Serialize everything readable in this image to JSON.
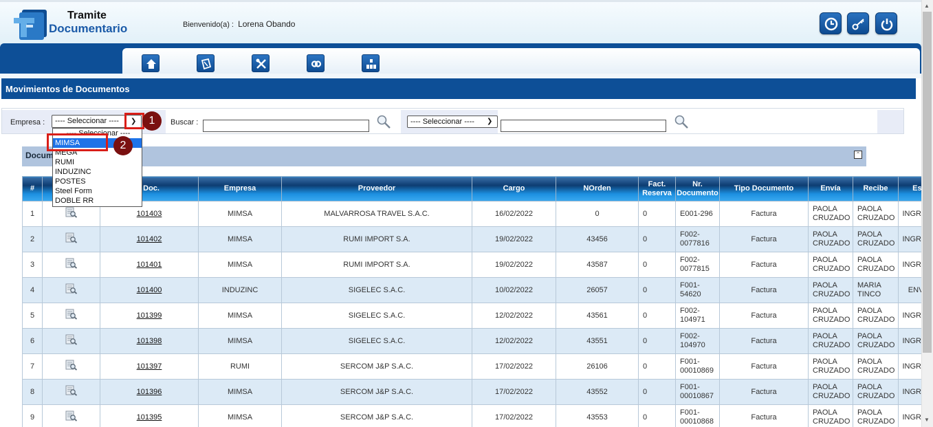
{
  "header": {
    "logo_line1": "Tramite",
    "logo_line2": "Documentario",
    "welcome_label": "Bienvenido(a) :",
    "user_name": "Lorena Obando",
    "buttons": [
      "clock-icon",
      "key-icon",
      "power-icon"
    ]
  },
  "nav": {
    "items": [
      "home-icon",
      "documents-icon",
      "tools-icon",
      "link-icon",
      "org-chart-icon"
    ]
  },
  "section": {
    "title": "Movimientos de Documentos"
  },
  "filter": {
    "empresa_label": "Empresa :",
    "empresa_selected": "---- Seleccionar ----",
    "buscar_label": "Buscar :",
    "second_select": "---- Seleccionar ----"
  },
  "dropdown": {
    "options": [
      "---- Seleccionar ----",
      "MIMSA",
      "MEGA",
      "RUMI",
      "INDUZINC",
      "POSTES",
      "Steel Form",
      "DOBLE RR"
    ],
    "highlighted": "MIMSA"
  },
  "annotations": [
    "1",
    "2"
  ],
  "panel": {
    "title": "Docum"
  },
  "table": {
    "headers": [
      "#",
      "",
      "l Doc.",
      "Empresa",
      "Proveedor",
      "Cargo",
      "NOrden",
      "Fact. Reserva",
      "Nr. Documento",
      "Tipo Documento",
      "Envía",
      "Recibe",
      "Estado"
    ],
    "rows": [
      [
        "1",
        "101403",
        "MIMSA",
        "MALVARROSA TRAVEL S.A.C.",
        "16/02/2022",
        "0",
        "0",
        "E001-296",
        "Factura",
        "PAOLA CRUZADO",
        "PAOLA CRUZADO",
        "INGRESADO"
      ],
      [
        "2",
        "101402",
        "MIMSA",
        "RUMI IMPORT S.A.",
        "19/02/2022",
        "43456",
        "0",
        "F002-0077816",
        "Factura",
        "PAOLA CRUZADO",
        "PAOLA CRUZADO",
        "INGRESADO"
      ],
      [
        "3",
        "101401",
        "MIMSA",
        "RUMI IMPORT S.A.",
        "19/02/2022",
        "43587",
        "0",
        "F002-0077815",
        "Factura",
        "PAOLA CRUZADO",
        "PAOLA CRUZADO",
        "INGRESADO"
      ],
      [
        "4",
        "101400",
        "INDUZINC",
        "SIGELEC S.A.C.",
        "10/02/2022",
        "26057",
        "0",
        "F001-54620",
        "Factura",
        "PAOLA CRUZADO",
        "MARIA TINCO",
        "ENVIADO"
      ],
      [
        "5",
        "101399",
        "MIMSA",
        "SIGELEC S.A.C.",
        "12/02/2022",
        "43561",
        "0",
        "F002-104971",
        "Factura",
        "PAOLA CRUZADO",
        "PAOLA CRUZADO",
        "INGRESADO"
      ],
      [
        "6",
        "101398",
        "MIMSA",
        "SIGELEC S.A.C.",
        "12/02/2022",
        "43551",
        "0",
        "F002-104970",
        "Factura",
        "PAOLA CRUZADO",
        "PAOLA CRUZADO",
        "INGRESADO"
      ],
      [
        "7",
        "101397",
        "RUMI",
        "SERCOM J&P S.A.C.",
        "17/02/2022",
        "26106",
        "0",
        "F001-00010869",
        "Factura",
        "PAOLA CRUZADO",
        "PAOLA CRUZADO",
        "INGRESADO"
      ],
      [
        "8",
        "101396",
        "MIMSA",
        "SERCOM J&P S.A.C.",
        "17/02/2022",
        "43552",
        "0",
        "F001-00010867",
        "Factura",
        "PAOLA CRUZADO",
        "PAOLA CRUZADO",
        "INGRESADO"
      ],
      [
        "9",
        "101395",
        "MIMSA",
        "SERCOM J&P S.A.C.",
        "17/02/2022",
        "43553",
        "0",
        "F001-00010868",
        "Factura",
        "PAOLA CRUZADO",
        "PAOLA CRUZADO",
        "INGRESADO"
      ]
    ]
  },
  "colors": {
    "brand_blue": "#0d4f97",
    "annotation_red": "#d91e18",
    "badge_dark_red": "#7a1010",
    "selected_option": "#1e73e8"
  }
}
